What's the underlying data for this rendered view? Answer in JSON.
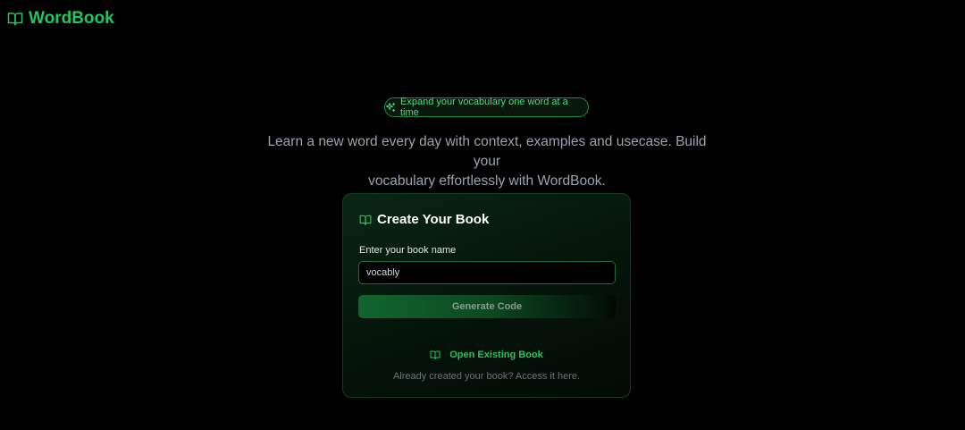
{
  "header": {
    "brand": "WordBook",
    "brand_icon": "book-open-icon"
  },
  "hero": {
    "badge_icon": "sparkles-icon",
    "badge_text": "Expand your vocabulary one word at a time",
    "tagline_line1": "Learn a new word every day with context, examples and usecase. Build your",
    "tagline_line2": "vocabulary effortlessly with WordBook."
  },
  "card": {
    "title_icon": "book-open-icon",
    "title": "Create Your Book",
    "input_label": "Enter your book name",
    "input_value": "vocably",
    "generate_label": "Generate Code",
    "open_icon": "book-open-icon",
    "open_label": "Open Existing Book",
    "helper_text": "Already created your book? Access it here."
  },
  "colors": {
    "accent": "#22c55e",
    "background": "#000000",
    "card_border": "#123d20",
    "muted_text": "#9ca3af"
  }
}
